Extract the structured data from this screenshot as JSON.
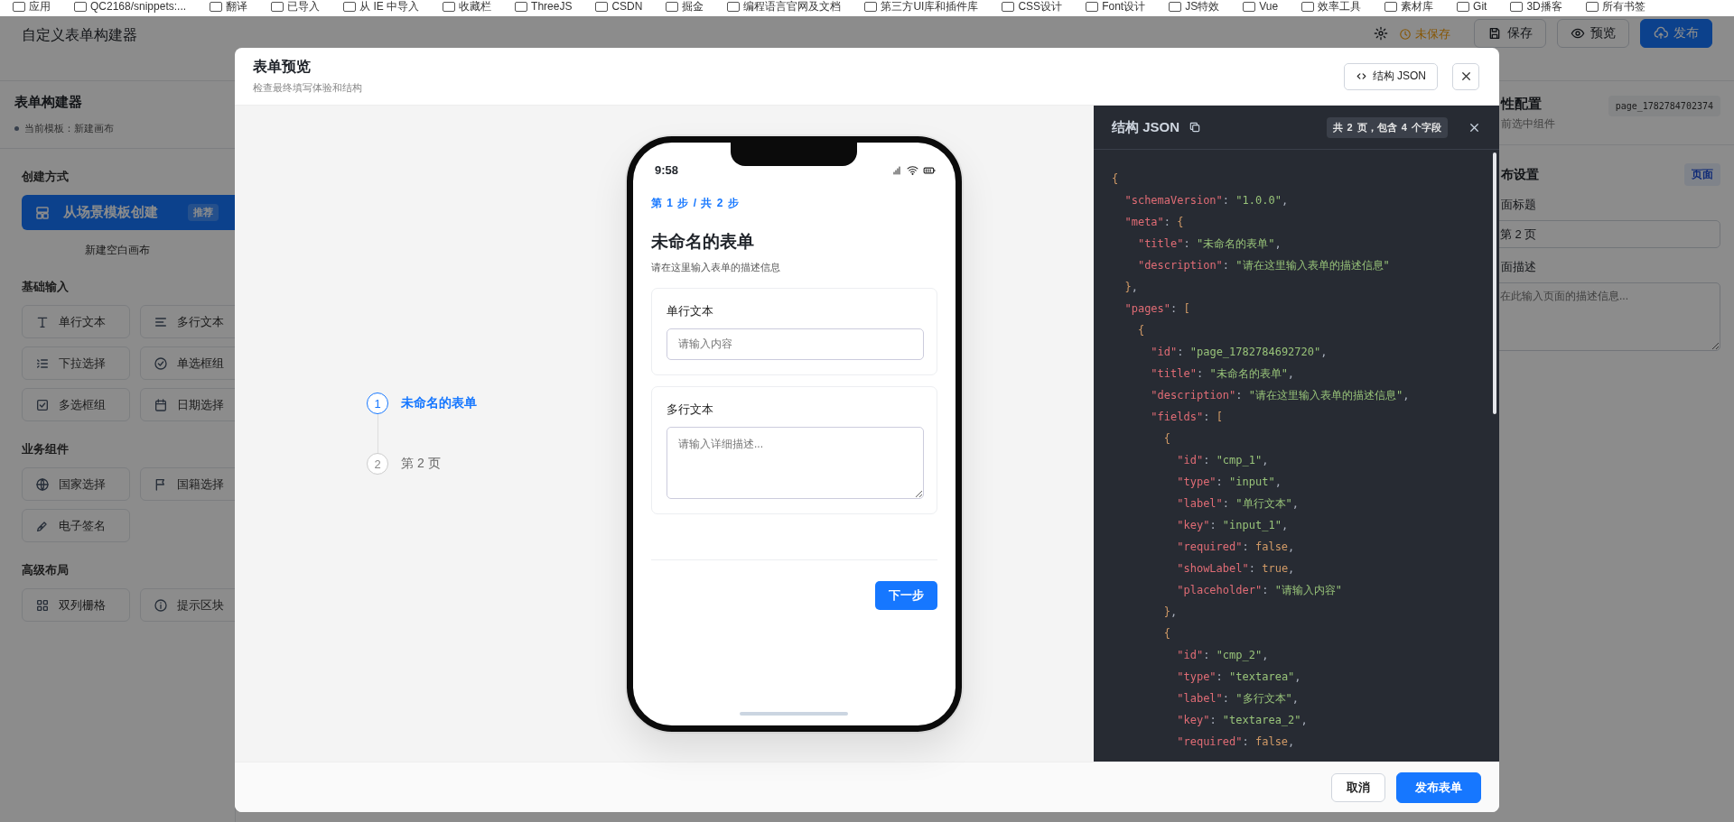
{
  "bookmarks": [
    "应用",
    "QC2168/snippets:...",
    "翻译",
    "已导入",
    "从 IE 中导入",
    "收藏栏",
    "ThreeJS",
    "CSDN",
    "掘金",
    "编程语言官网及文档",
    "第三方UI库和插件库",
    "CSS设计",
    "Font设计",
    "JS特效",
    "Vue",
    "效率工具",
    "素材库",
    "Git",
    "3D播客",
    "所有书签"
  ],
  "app_header": {
    "title": "自定义表单构建器",
    "status": "未保存",
    "buttons": [
      {
        "label": "保存",
        "kind": "outline"
      },
      {
        "label": "预览",
        "kind": "outline"
      },
      {
        "label": "发布",
        "kind": "primary"
      }
    ]
  },
  "sidebar": {
    "title": "表单构建器",
    "template": "当前模板：新建画布",
    "sections": [
      {
        "kind": "create",
        "title": "创建方式",
        "primary_button": "从场景模板创建",
        "badge": "推荐",
        "link": "新建空白画布"
      },
      {
        "kind": "components",
        "title": "基础输入",
        "items": [
          "单行文本",
          "多行文本",
          "下拉选择",
          "单选框组",
          "多选框组",
          "日期选择"
        ]
      },
      {
        "kind": "components",
        "title": "业务组件",
        "items": [
          "国家选择",
          "国籍选择",
          "电子签名"
        ]
      },
      {
        "kind": "components",
        "title": "高级布局",
        "items": [
          "双列栅格",
          "提示区块"
        ]
      }
    ]
  },
  "properties_panel": {
    "title": "性配置",
    "subtitle": "前选中组件",
    "id_tag": "page_1782784702374",
    "section": "布设置",
    "section_badge": "页面",
    "fields": [
      {
        "kind": "input",
        "label": "面标题",
        "value": "第 2 页"
      },
      {
        "kind": "textarea",
        "label": "面描述",
        "placeholder": "在此输入页面的描述信息..."
      }
    ]
  },
  "modal": {
    "title": "表单预览",
    "subtitle": "检查最终填写体验和结构",
    "json_button": "结构 JSON",
    "steps": [
      {
        "number": "1",
        "label": "未命名的表单",
        "selected": true
      },
      {
        "number": "2",
        "label": "第 2 页",
        "selected": false
      }
    ],
    "phone": {
      "time": "9:58",
      "step_text": "第 1 步 / 共 2 步",
      "title": "未命名的表单",
      "description": "请在这里输入表单的描述信息",
      "fields": [
        {
          "kind": "input",
          "label": "单行文本",
          "placeholder": "请输入内容"
        },
        {
          "kind": "textarea",
          "label": "多行文本",
          "placeholder": "请输入详细描述..."
        }
      ],
      "next_button": "下一步"
    },
    "json_panel": {
      "title": "结构 JSON",
      "summary": "共 2 页，包含 4 个字段",
      "lines": [
        "{",
        "  \"schemaVersion\": \"1.0.0\",",
        "  \"meta\": {",
        "    \"title\": \"未命名的表单\",",
        "    \"description\": \"请在这里输入表单的描述信息\"",
        "  },",
        "  \"pages\": [",
        "    {",
        "      \"id\": \"page_1782784692720\",",
        "      \"title\": \"未命名的表单\",",
        "      \"description\": \"请在这里输入表单的描述信息\",",
        "      \"fields\": [",
        "        {",
        "          \"id\": \"cmp_1\",",
        "          \"type\": \"input\",",
        "          \"label\": \"单行文本\",",
        "          \"key\": \"input_1\",",
        "          \"required\": false,",
        "          \"showLabel\": true,",
        "          \"placeholder\": \"请输入内容\"",
        "        },",
        "        {",
        "          \"id\": \"cmp_2\",",
        "          \"type\": \"textarea\",",
        "          \"label\": \"多行文本\",",
        "          \"key\": \"textarea_2\",",
        "          \"required\": false,"
      ]
    },
    "footer_buttons": [
      {
        "label": "取消",
        "kind": "secondary"
      },
      {
        "label": "发布表单",
        "kind": "primary"
      }
    ]
  }
}
